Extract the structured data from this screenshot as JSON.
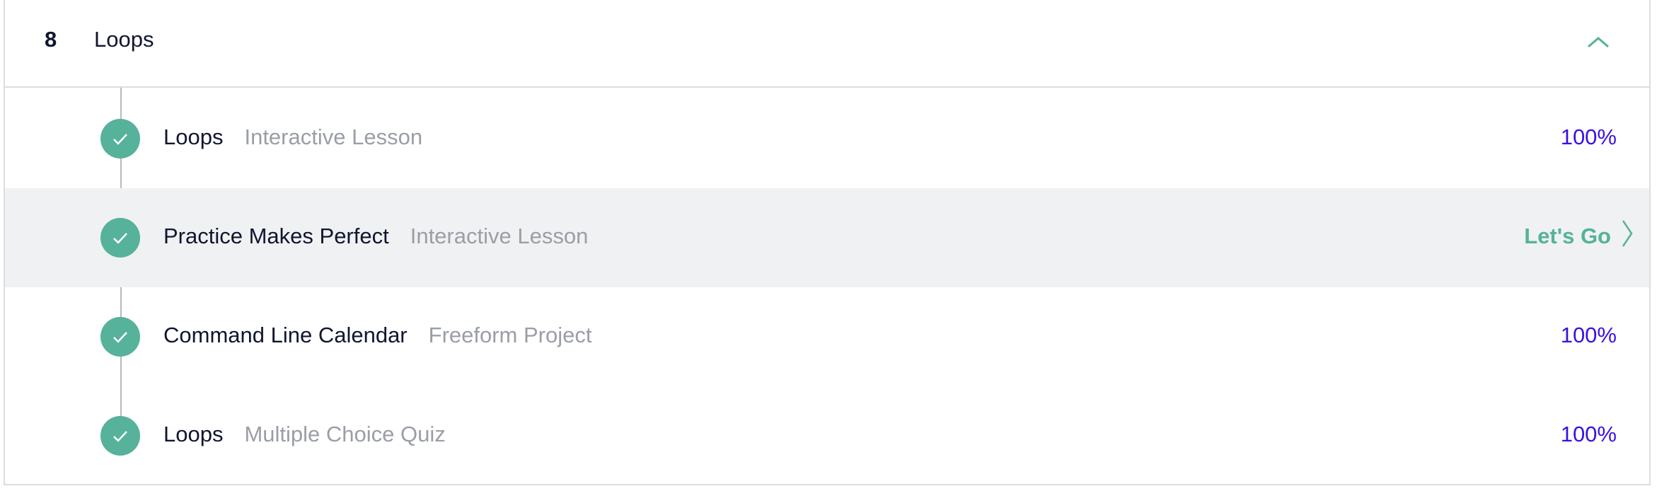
{
  "module": {
    "number": "8",
    "title": "Loops"
  },
  "items": [
    {
      "title": "Loops",
      "type": "Interactive Lesson",
      "status": "100%"
    },
    {
      "title": "Practice Makes Perfect",
      "type": "Interactive Lesson",
      "status": "Let's Go"
    },
    {
      "title": "Command Line Calendar",
      "type": "Freeform Project",
      "status": "100%"
    },
    {
      "title": "Loops",
      "type": "Multiple Choice Quiz",
      "status": "100%"
    }
  ],
  "icons": {
    "collapse": "chevron-up-icon",
    "complete": "check-circle-icon",
    "go": "chevron-right-icon"
  },
  "colors": {
    "accent": "#56b29a",
    "progress": "#3a10e5",
    "text": "#10162f",
    "muted": "#9a9ea6"
  }
}
